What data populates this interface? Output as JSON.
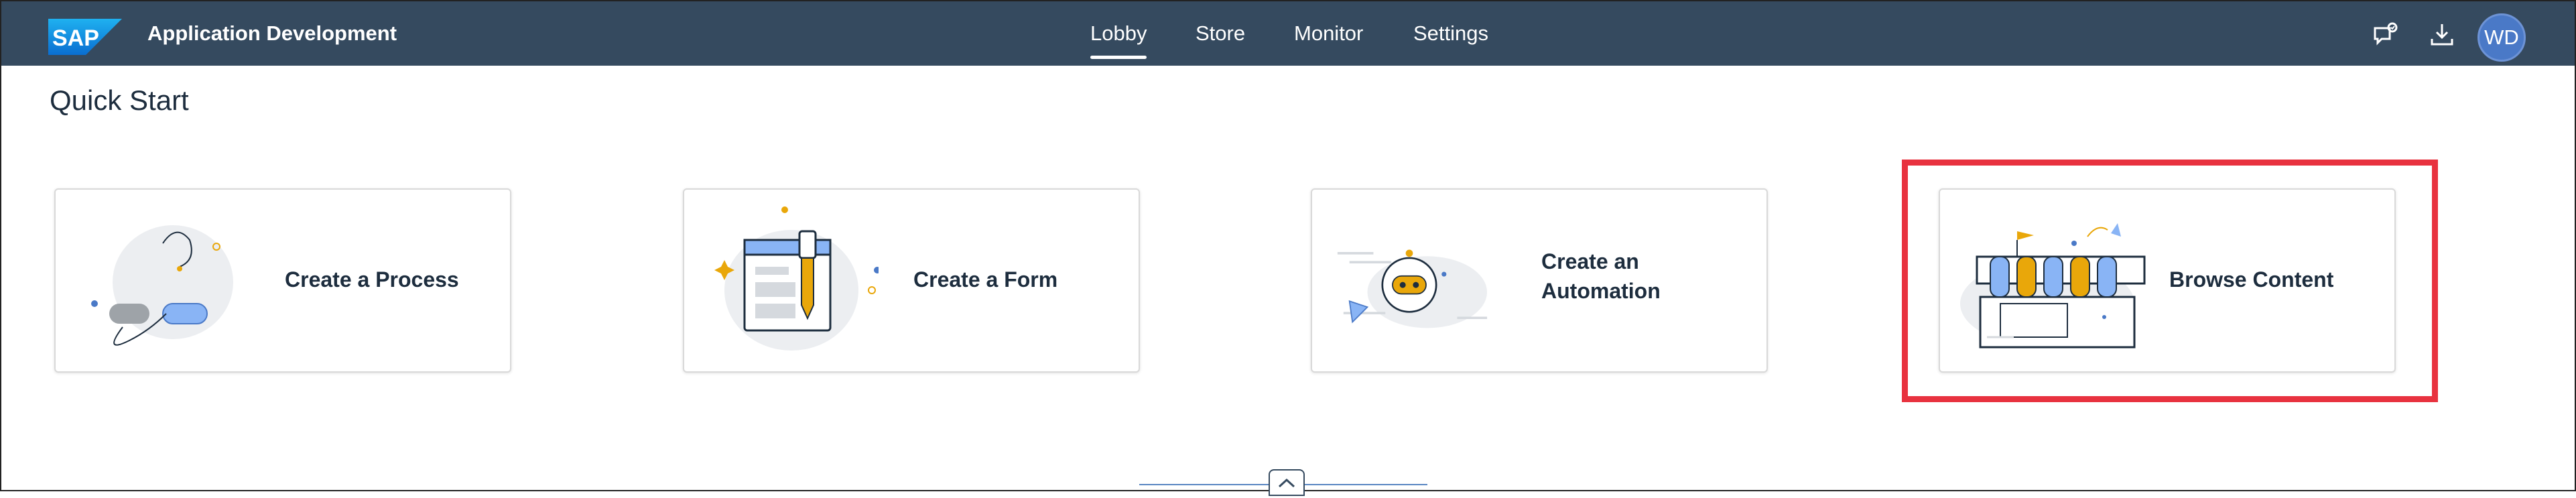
{
  "shell": {
    "logo_text": "SAP",
    "app_title": "Application Development",
    "tabs": [
      {
        "label": "Lobby",
        "active": true
      },
      {
        "label": "Store",
        "active": false
      },
      {
        "label": "Monitor",
        "active": false
      },
      {
        "label": "Settings",
        "active": false
      }
    ],
    "icons": [
      "feedback-icon",
      "download-icon"
    ],
    "avatar_initials": "WD",
    "colors": {
      "shell_bg": "#354a5f",
      "avatar_bg": "#4a79c7",
      "highlight": "#e8323f"
    }
  },
  "main": {
    "section_title": "Quick Start",
    "cards": [
      {
        "label": "Create a Process",
        "icon": "process-illustration"
      },
      {
        "label": "Create a Form",
        "icon": "form-illustration"
      },
      {
        "label": "Create an Automation",
        "icon": "automation-illustration"
      },
      {
        "label": "Browse Content",
        "icon": "store-illustration"
      }
    ]
  },
  "footer": {
    "collapse_icon": "chevron-up-icon"
  }
}
